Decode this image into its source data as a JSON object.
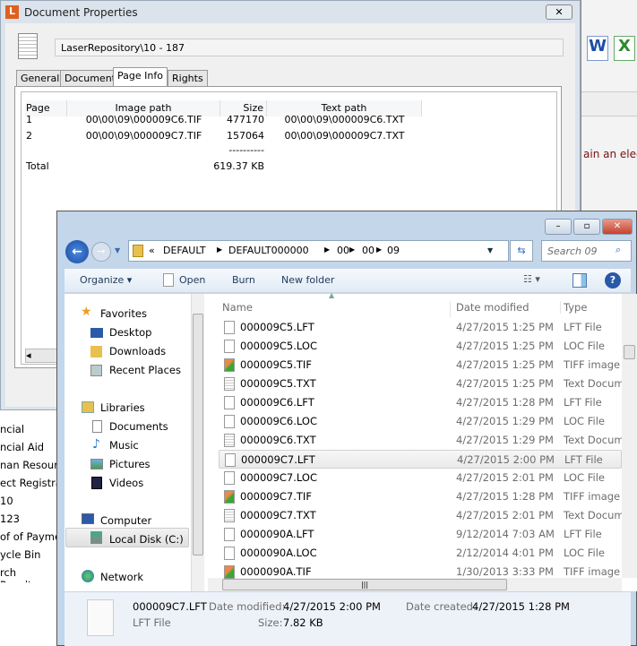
{
  "background_app": {
    "snippet": "ain an electr",
    "icons": [
      "word-icon",
      "excel-icon"
    ]
  },
  "doc_props": {
    "title": "Document Properties",
    "app_letter": "L",
    "path": "LaserRepository\\10 - 187",
    "tabs": [
      {
        "label": "General"
      },
      {
        "label": "Document"
      },
      {
        "label": "Page Info",
        "active": true
      },
      {
        "label": "Rights"
      }
    ],
    "columns": [
      "Page",
      "Image path",
      "Size",
      "Text path"
    ],
    "rows": [
      {
        "page": "1",
        "image": "00\\00\\09\\000009C6.TIF",
        "size": "477170",
        "text": "00\\00\\09\\000009C6.TXT"
      },
      {
        "page": "2",
        "image": "00\\00\\09\\000009C7.TIF",
        "size": "157064",
        "text": "00\\00\\09\\000009C7.TXT"
      }
    ],
    "separator": "----------",
    "total_label": "Total",
    "total_value": "619.37 KB"
  },
  "left_list": [
    "ncial",
    "ncial Aid",
    "nan Resourc",
    "ect Registrat",
    "10",
    "123",
    "of of Payme",
    "ycle Bin",
    "rch Results"
  ],
  "explorer": {
    "breadcrumb": [
      "DEFAULT",
      "DEFAULT000000",
      "00",
      "00",
      "09"
    ],
    "breadcrumb_prefix": "«",
    "search_placeholder": "Search 09",
    "toolbar": {
      "organize": "Organize",
      "open": "Open",
      "burn": "Burn",
      "new_folder": "New folder"
    },
    "nav": {
      "favorites": "Favorites",
      "fav_items": [
        "Desktop",
        "Downloads",
        "Recent Places"
      ],
      "libraries": "Libraries",
      "lib_items": [
        "Documents",
        "Music",
        "Pictures",
        "Videos"
      ],
      "computer": "Computer",
      "local_disk": "Local Disk (C:)",
      "network": "Network"
    },
    "columns": {
      "name": "Name",
      "date": "Date modified",
      "type": "Type"
    },
    "files": [
      {
        "name": "000009C5.LFT",
        "date": "4/27/2015 1:25 PM",
        "type": "LFT File",
        "kind": "blank"
      },
      {
        "name": "000009C5.LOC",
        "date": "4/27/2015 1:25 PM",
        "type": "LOC File",
        "kind": "blank"
      },
      {
        "name": "000009C5.TIF",
        "date": "4/27/2015 1:25 PM",
        "type": "TIFF image",
        "kind": "tif"
      },
      {
        "name": "000009C5.TXT",
        "date": "4/27/2015 1:25 PM",
        "type": "Text Docum",
        "kind": "txt"
      },
      {
        "name": "000009C6.LFT",
        "date": "4/27/2015 1:28 PM",
        "type": "LFT File",
        "kind": "blank"
      },
      {
        "name": "000009C6.LOC",
        "date": "4/27/2015 1:29 PM",
        "type": "LOC File",
        "kind": "blank"
      },
      {
        "name": "000009C6.TXT",
        "date": "4/27/2015 1:29 PM",
        "type": "Text Docum",
        "kind": "txt"
      },
      {
        "name": "000009C7.LFT",
        "date": "4/27/2015 2:00 PM",
        "type": "LFT File",
        "kind": "blank",
        "selected": true
      },
      {
        "name": "000009C7.LOC",
        "date": "4/27/2015 2:01 PM",
        "type": "LOC File",
        "kind": "blank"
      },
      {
        "name": "000009C7.TIF",
        "date": "4/27/2015 1:28 PM",
        "type": "TIFF image",
        "kind": "tif"
      },
      {
        "name": "000009C7.TXT",
        "date": "4/27/2015 2:01 PM",
        "type": "Text Docum",
        "kind": "txt"
      },
      {
        "name": "0000090A.LFT",
        "date": "9/12/2014 7:03 AM",
        "type": "LFT File",
        "kind": "blank"
      },
      {
        "name": "0000090A.LOC",
        "date": "2/12/2014 4:01 PM",
        "type": "LOC File",
        "kind": "blank"
      },
      {
        "name": "0000090A.TIF",
        "date": "1/30/2013 3:33 PM",
        "type": "TIFF image",
        "kind": "tif"
      }
    ],
    "details": {
      "name": "000009C7.LFT",
      "type": "LFT File",
      "modified_label": "Date modified:",
      "modified": "4/27/2015 2:00 PM",
      "created_label": "Date created:",
      "created": "4/27/2015 1:28 PM",
      "size_label": "Size:",
      "size": "7.82 KB"
    }
  }
}
